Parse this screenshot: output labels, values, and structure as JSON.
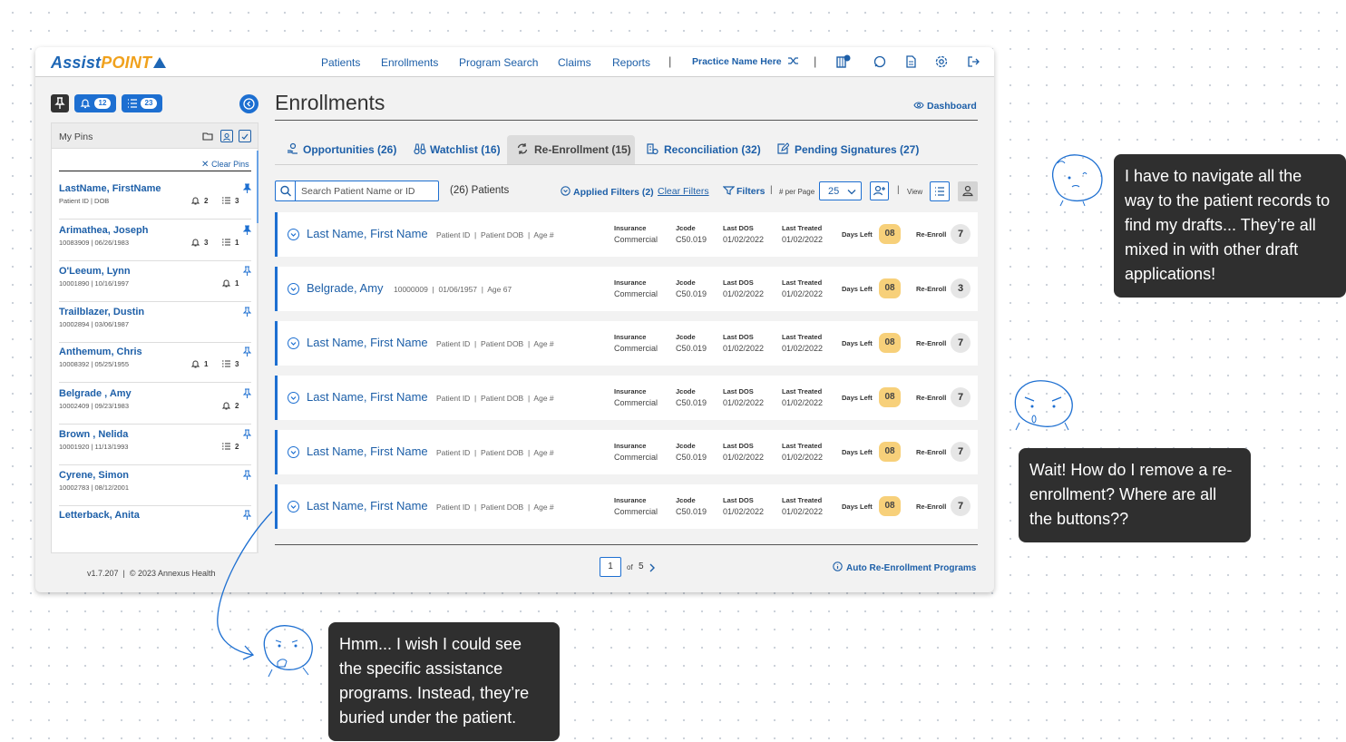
{
  "app": {
    "logo": {
      "part1": "Assist",
      "part2": "POINT"
    },
    "nav": [
      "Patients",
      "Enrollments",
      "Program Search",
      "Claims",
      "Reports"
    ],
    "practice": "Practice Name Here",
    "nav_icons": [
      "notifications-book-icon",
      "chat-icon",
      "document-icon",
      "settings-icon",
      "logout-icon"
    ],
    "colors": {
      "primary": "#1d6fd1",
      "accent": "#f0a11c",
      "days_badge": "#f7d07a"
    }
  },
  "sidebar": {
    "notif_count": "12",
    "list_count": "23",
    "pins_title": "My Pins",
    "clear_pins": "Clear Pins",
    "items": [
      {
        "name": "LastName, FirstName",
        "meta": "Patient ID | DOB",
        "bell": "2",
        "list": "3"
      },
      {
        "name": "Arimathea, Joseph",
        "meta": "10083909 | 06/26/1983",
        "bell": "3",
        "list": "1"
      },
      {
        "name": "O'Leeum, Lynn",
        "meta": "10001890 | 10/16/1997",
        "bell": "1"
      },
      {
        "name": "Trailblazer, Dustin",
        "meta": "10002894 | 03/06/1987"
      },
      {
        "name": "Anthemum, Chris",
        "meta": "10008392 | 05/25/1955",
        "bell": "1",
        "list": "3"
      },
      {
        "name": "Belgrade , Amy",
        "meta": "10002409 | 09/23/1983",
        "bell": "2"
      },
      {
        "name": "Brown , Nelida",
        "meta": "10001920 | 11/13/1993",
        "list": "2"
      },
      {
        "name": "Cyrene, Simon",
        "meta": "10002783 | 08/12/2001"
      },
      {
        "name": "Letterback, Anita",
        "meta": ""
      }
    ],
    "footer": "v1.7.207  |  © 2023 Annexus Health"
  },
  "main": {
    "title": "Enrollments",
    "dashboard": "Dashboard",
    "tabs": [
      {
        "label": "Opportunities (26)",
        "icon": "hand-coin-icon"
      },
      {
        "label": "Watchlist (16)",
        "icon": "binoculars-icon"
      },
      {
        "label": "Re-Enrollment (15)",
        "icon": "refresh-icon",
        "active": true
      },
      {
        "label": "Reconciliation (32)",
        "icon": "reconcile-icon"
      },
      {
        "label": "Pending Signatures (27)",
        "icon": "signature-icon"
      }
    ],
    "search_placeholder": "Search Patient Name or ID",
    "patient_count": "(26) Patients",
    "applied_filters": "Applied Filters (2)",
    "clear_filters": "Clear Filters",
    "filters": "Filters",
    "per_page_label": "# per Page",
    "per_page_value": "25",
    "view_label": "View",
    "col_labels": {
      "insurance": "Insurance",
      "jcode": "Jcode",
      "last_dos": "Last DOS",
      "last_treated": "Last Treated",
      "days_left": "Days Left",
      "reenroll": "Re-Enroll"
    },
    "rows": [
      {
        "name": "Last Name, First Name",
        "id": "Patient ID",
        "dob": "Patient DOB",
        "age": "Age #",
        "insurance": "Commercial",
        "jcode": "C50.019",
        "last_dos": "01/02/2022",
        "last_treated": "01/02/2022",
        "days_left": "08",
        "reenroll": "7"
      },
      {
        "name": "Belgrade, Amy",
        "id": "10000009",
        "dob": "01/06/1957",
        "age": "Age 67",
        "insurance": "Commercial",
        "jcode": "C50.019",
        "last_dos": "01/02/2022",
        "last_treated": "01/02/2022",
        "days_left": "08",
        "reenroll": "3"
      },
      {
        "name": "Last Name, First Name",
        "id": "Patient ID",
        "dob": "Patient DOB",
        "age": "Age #",
        "insurance": "Commercial",
        "jcode": "C50.019",
        "last_dos": "01/02/2022",
        "last_treated": "01/02/2022",
        "days_left": "08",
        "reenroll": "7"
      },
      {
        "name": "Last Name, First Name",
        "id": "Patient ID",
        "dob": "Patient DOB",
        "age": "Age #",
        "insurance": "Commercial",
        "jcode": "C50.019",
        "last_dos": "01/02/2022",
        "last_treated": "01/02/2022",
        "days_left": "08",
        "reenroll": "7"
      },
      {
        "name": "Last Name, First Name",
        "id": "Patient ID",
        "dob": "Patient DOB",
        "age": "Age #",
        "insurance": "Commercial",
        "jcode": "C50.019",
        "last_dos": "01/02/2022",
        "last_treated": "01/02/2022",
        "days_left": "08",
        "reenroll": "7"
      },
      {
        "name": "Last Name, First Name",
        "id": "Patient ID",
        "dob": "Patient DOB",
        "age": "Age #",
        "insurance": "Commercial",
        "jcode": "C50.019",
        "last_dos": "01/02/2022",
        "last_treated": "01/02/2022",
        "days_left": "08",
        "reenroll": "7"
      }
    ],
    "pagination": {
      "current": "1",
      "of": "of",
      "total": "5"
    },
    "auto_reenroll": "Auto Re-Enrollment Programs"
  },
  "annotations": [
    "I have to navigate all the way to the patient records to find my drafts... They’re all mixed in with other draft applications!",
    "Wait! How do I remove a re-enrollment? Where are all the buttons??",
    "Hmm... I wish I could see the specific assistance programs. Instead, they’re buried under the patient."
  ]
}
